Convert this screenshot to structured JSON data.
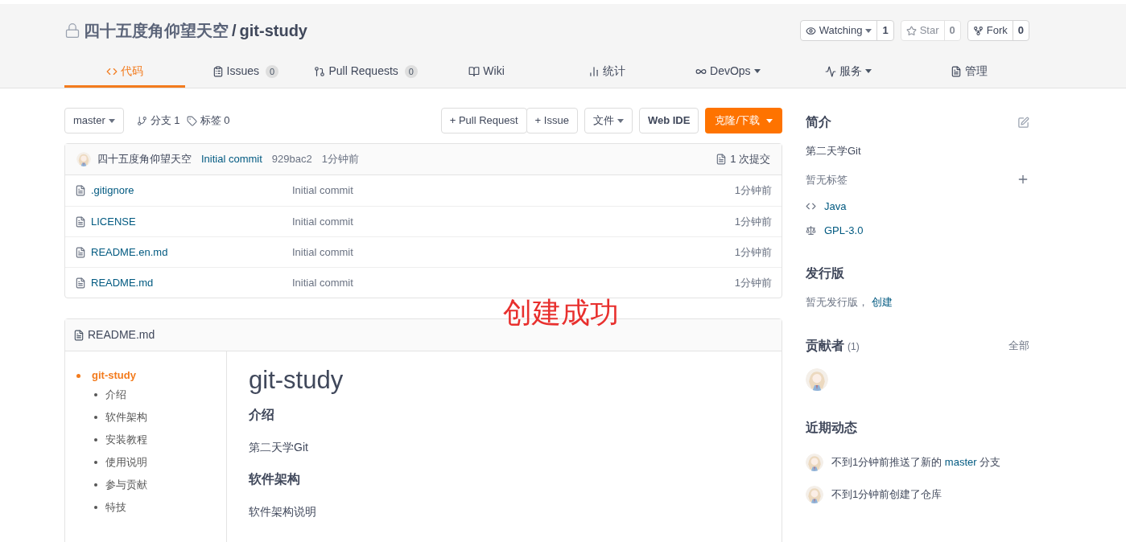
{
  "repo": {
    "owner": "四十五度角仰望天空",
    "separator": "/",
    "name": "git-study"
  },
  "actions": [
    {
      "label": "Watching",
      "count": "1",
      "dropdown": true,
      "disabled": false
    },
    {
      "label": "Star",
      "count": "0",
      "dropdown": false,
      "disabled": true
    },
    {
      "label": "Fork",
      "count": "0",
      "dropdown": false,
      "disabled": false
    }
  ],
  "tabs": [
    {
      "label": "代码",
      "selected": true,
      "dropdown": false
    },
    {
      "label": "Issues",
      "count": "0",
      "selected": false,
      "dropdown": false
    },
    {
      "label": "Pull Requests",
      "count": "0",
      "selected": false,
      "dropdown": false
    },
    {
      "label": "Wiki",
      "selected": false,
      "dropdown": false
    },
    {
      "label": "统计",
      "selected": false,
      "dropdown": false
    },
    {
      "label": "DevOps",
      "selected": false,
      "dropdown": true
    },
    {
      "label": "服务",
      "selected": false,
      "dropdown": true
    },
    {
      "label": "管理",
      "selected": false,
      "dropdown": false
    }
  ],
  "toolbar": {
    "branch": "master",
    "branches": "分支 1",
    "tags": "标签 0",
    "buttons": [
      "+ Pull Request",
      "+ Issue"
    ],
    "file_menu": "文件",
    "web_ide": "Web IDE",
    "clone": "克隆/下载"
  },
  "last_commit": {
    "author": "四十五度角仰望天空",
    "message": "Initial commit",
    "hash": "929bac2",
    "time": "1分钟前",
    "commits": "1 次提交"
  },
  "files": [
    {
      "name": ".gitignore",
      "message": "Initial commit",
      "time": "1分钟前"
    },
    {
      "name": "LICENSE",
      "message": "Initial commit",
      "time": "1分钟前"
    },
    {
      "name": "README.en.md",
      "message": "Initial commit",
      "time": "1分钟前"
    },
    {
      "name": "README.md",
      "message": "Initial commit",
      "time": "1分钟前"
    }
  ],
  "annotation": "创建成功",
  "readme": {
    "title": "README.md",
    "toc": [
      {
        "label": "git-study",
        "selected": true,
        "children": [
          {
            "label": "介绍",
            "selected": false
          },
          {
            "label": "软件架构",
            "selected": false
          },
          {
            "label": "安装教程",
            "selected": false
          },
          {
            "label": "使用说明",
            "selected": false
          },
          {
            "label": "参与贡献",
            "selected": false
          },
          {
            "label": "特技",
            "selected": false
          }
        ]
      }
    ],
    "content": [
      {
        "kind": "h1",
        "text": "git-study"
      },
      {
        "kind": "h2",
        "text": "介绍"
      },
      {
        "kind": "p",
        "text": "第二天学Git"
      },
      {
        "kind": "h2",
        "text": "软件架构"
      },
      {
        "kind": "p",
        "text": "软件架构说明"
      }
    ]
  },
  "sidebar": {
    "intro": {
      "title": "简介",
      "description": "第二天学Git",
      "tags_empty": "暂无标签",
      "language": "Java",
      "license": "GPL-3.0"
    },
    "releases": {
      "title": "发行版",
      "empty": "暂无发行版，",
      "create_link": "创建"
    },
    "contributors": {
      "title": "贡献者",
      "count": "(1)",
      "all_link": "全部"
    },
    "activity": {
      "title": "近期动态",
      "items": [
        {
          "text": "不到1分钟前推送了新的",
          "link": "master",
          "suffix": "分支"
        },
        {
          "text": "不到1分钟前创建了仓库"
        }
      ]
    }
  }
}
